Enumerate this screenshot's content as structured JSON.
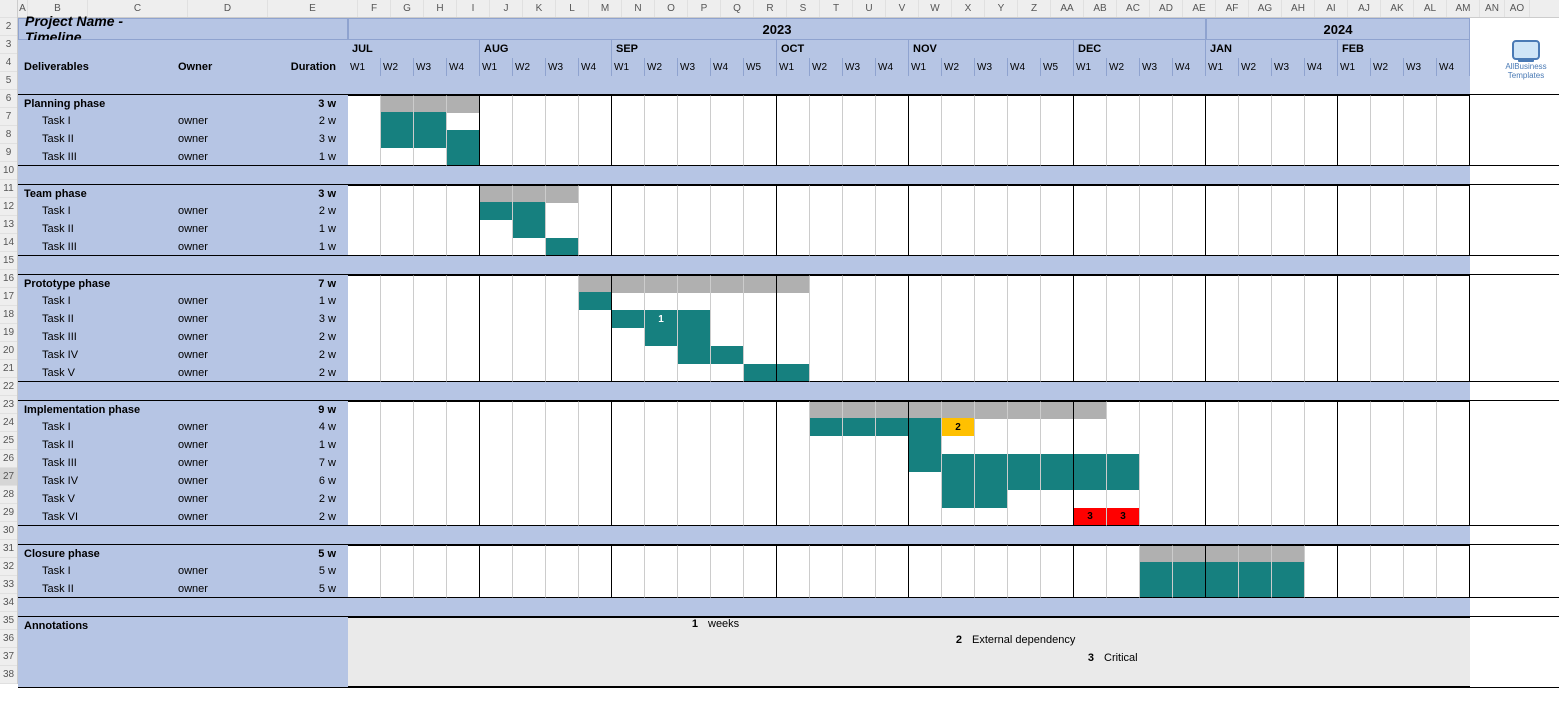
{
  "colLetters": [
    "A",
    "B",
    "C",
    "D",
    "E",
    "F",
    "G",
    "H",
    "I",
    "J",
    "K",
    "L",
    "M",
    "N",
    "O",
    "P",
    "Q",
    "R",
    "S",
    "T",
    "U",
    "V",
    "W",
    "X",
    "Y",
    "Z",
    "AA",
    "AB",
    "AC",
    "AD",
    "AE",
    "AF",
    "AG",
    "AH",
    "AI",
    "AJ",
    "AK",
    "AL",
    "AM",
    "AN",
    "AO"
  ],
  "rowNumbers": [
    2,
    3,
    4,
    5,
    6,
    7,
    8,
    9,
    10,
    11,
    12,
    13,
    14,
    15,
    16,
    17,
    18,
    19,
    20,
    21,
    22,
    23,
    24,
    25,
    26,
    27,
    28,
    29,
    30,
    31,
    32,
    33,
    34,
    35,
    36,
    37,
    38
  ],
  "title": "Project Name - Timeline",
  "headers": {
    "deliverables": "Deliverables",
    "owner": "Owner",
    "duration": "Duration",
    "annotations": "Annotations"
  },
  "years": [
    {
      "label": "2023",
      "span": 26
    },
    {
      "label": "2024",
      "span": 8
    }
  ],
  "months": [
    {
      "label": "JUL",
      "weeks": [
        "W1",
        "W2",
        "W3",
        "W4"
      ]
    },
    {
      "label": "AUG",
      "weeks": [
        "W1",
        "W2",
        "W3",
        "W4"
      ]
    },
    {
      "label": "SEP",
      "weeks": [
        "W1",
        "W2",
        "W3",
        "W4",
        "W5"
      ]
    },
    {
      "label": "OCT",
      "weeks": [
        "W1",
        "W2",
        "W3",
        "W4"
      ]
    },
    {
      "label": "NOV",
      "weeks": [
        "W1",
        "W2",
        "W3",
        "W4",
        "W5"
      ]
    },
    {
      "label": "DEC",
      "weeks": [
        "W1",
        "W2",
        "W3",
        "W4"
      ]
    },
    {
      "label": "JAN",
      "weeks": [
        "W1",
        "W2",
        "W3",
        "W4"
      ]
    },
    {
      "label": "FEB",
      "weeks": [
        "W1",
        "W2",
        "W3",
        "W4"
      ]
    }
  ],
  "phases": [
    {
      "name": "Planning phase",
      "duration": "3 w",
      "barStart": 1,
      "barLen": 3,
      "tasks": [
        {
          "name": "Task I",
          "owner": "owner",
          "duration": "2 w",
          "start": 1,
          "len": 2,
          "color": "teal"
        },
        {
          "name": "Task II",
          "owner": "owner",
          "duration": "3 w",
          "start": 1,
          "len": 3,
          "color": "teal"
        },
        {
          "name": "Task III",
          "owner": "owner",
          "duration": "1 w",
          "start": 3,
          "len": 1,
          "color": "teal"
        }
      ]
    },
    {
      "name": "Team phase",
      "duration": "3 w",
      "barStart": 4,
      "barLen": 3,
      "tasks": [
        {
          "name": "Task I",
          "owner": "owner",
          "duration": "2 w",
          "start": 4,
          "len": 2,
          "color": "teal"
        },
        {
          "name": "Task II",
          "owner": "owner",
          "duration": "1 w",
          "start": 5,
          "len": 1,
          "color": "teal"
        },
        {
          "name": "Task III",
          "owner": "owner",
          "duration": "1 w",
          "start": 6,
          "len": 1,
          "color": "teal"
        }
      ]
    },
    {
      "name": "Prototype phase",
      "duration": "7 w",
      "barStart": 7,
      "barLen": 7,
      "tasks": [
        {
          "name": "Task I",
          "owner": "owner",
          "duration": "1 w",
          "start": 7,
          "len": 1,
          "color": "teal"
        },
        {
          "name": "Task II",
          "owner": "owner",
          "duration": "3 w",
          "start": 8,
          "len": 3,
          "color": "teal",
          "label": "1"
        },
        {
          "name": "Task III",
          "owner": "owner",
          "duration": "2 w",
          "start": 9,
          "len": 2,
          "color": "teal"
        },
        {
          "name": "Task IV",
          "owner": "owner",
          "duration": "2 w",
          "start": 10,
          "len": 2,
          "color": "teal"
        },
        {
          "name": "Task V",
          "owner": "owner",
          "duration": "2 w",
          "start": 12,
          "len": 2,
          "color": "teal"
        }
      ]
    },
    {
      "name": "Implementation phase",
      "duration": "9 w",
      "barStart": 14,
      "barLen": 9,
      "tasks": [
        {
          "name": "Task I",
          "owner": "owner",
          "duration": "4 w",
          "start": 14,
          "len": 4,
          "color": "teal",
          "append": {
            "color": "yellow",
            "len": 1,
            "label": "2"
          }
        },
        {
          "name": "Task II",
          "owner": "owner",
          "duration": "1 w",
          "start": 17,
          "len": 1,
          "color": "teal"
        },
        {
          "name": "Task III",
          "owner": "owner",
          "duration": "7 w",
          "start": 17,
          "len": 7,
          "color": "teal"
        },
        {
          "name": "Task IV",
          "owner": "owner",
          "duration": "6 w",
          "start": 18,
          "len": 6,
          "color": "teal"
        },
        {
          "name": "Task V",
          "owner": "owner",
          "duration": "2 w",
          "start": 18,
          "len": 2,
          "color": "teal"
        },
        {
          "name": "Task VI",
          "owner": "owner",
          "duration": "2 w",
          "start": 22,
          "len": 2,
          "color": "red",
          "label": "3",
          "label2": "3"
        }
      ]
    },
    {
      "name": "Closure phase",
      "duration": "5 w",
      "barStart": 24,
      "barLen": 5,
      "tasks": [
        {
          "name": "Task I",
          "owner": "owner",
          "duration": "5 w",
          "start": 24,
          "len": 5,
          "color": "teal"
        },
        {
          "name": "Task II",
          "owner": "owner",
          "duration": "5 w",
          "start": 24,
          "len": 5,
          "color": "teal"
        }
      ]
    }
  ],
  "annotations": [
    {
      "key": "1",
      "text": "weeks"
    },
    {
      "key": "2",
      "text": "External dependency"
    },
    {
      "key": "3",
      "text": "Critical"
    }
  ],
  "logo": "AllBusiness Templates",
  "selectedRow": 27,
  "totalWeeks": 34,
  "colors": {
    "headerBlue": "#b6c5e4",
    "teal": "#16807f",
    "grey": "#b0b0b0",
    "yellow": "#ffc000",
    "red": "#ff0000"
  }
}
